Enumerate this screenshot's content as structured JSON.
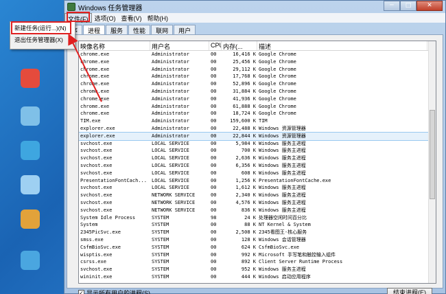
{
  "window": {
    "title": "Windows 任务管理器",
    "buttons": {
      "minimize": "─",
      "maximize": "□",
      "close": "✕"
    }
  },
  "menubar": [
    "文件(F)",
    "选项(O)",
    "查看(V)",
    "帮助(H)"
  ],
  "file_menu": {
    "items": [
      "新建任务(运行...)(N)",
      "退出任务管理器(X)"
    ]
  },
  "tabs": [
    "应用程序",
    "进程",
    "服务",
    "性能",
    "联网",
    "用户"
  ],
  "tab_partial": "序",
  "selected_tab_index": 1,
  "columns": [
    "映像名称",
    "用户名",
    "CPU",
    "内存(...",
    "描述"
  ],
  "processes": [
    {
      "name": "chrome.exe",
      "user": "Administrator",
      "cpu": "00",
      "mem": "16,416 K",
      "desc": "Google Chrome"
    },
    {
      "name": "chrome.exe",
      "user": "Administrator",
      "cpu": "00",
      "mem": "25,456 K",
      "desc": "Google Chrome"
    },
    {
      "name": "chrome.exe",
      "user": "Administrator",
      "cpu": "00",
      "mem": "29,112 K",
      "desc": "Google Chrome"
    },
    {
      "name": "chrome.exe",
      "user": "Administrator",
      "cpu": "00",
      "mem": "17,768 K",
      "desc": "Google Chrome"
    },
    {
      "name": "chrome.exe",
      "user": "Administrator",
      "cpu": "00",
      "mem": "52,896 K",
      "desc": "Google Chrome"
    },
    {
      "name": "chrome.exe",
      "user": "Administrator",
      "cpu": "00",
      "mem": "31,884 K",
      "desc": "Google Chrome"
    },
    {
      "name": "chrome.exe",
      "user": "Administrator",
      "cpu": "00",
      "mem": "41,936 K",
      "desc": "Google Chrome"
    },
    {
      "name": "chrome.exe",
      "user": "Administrator",
      "cpu": "00",
      "mem": "61,888 K",
      "desc": "Google Chrome"
    },
    {
      "name": "chrome.exe",
      "user": "Administrator",
      "cpu": "00",
      "mem": "18,724 K",
      "desc": "Google Chrome"
    },
    {
      "name": "TIM.exe",
      "user": "Administrator",
      "cpu": "00",
      "mem": "159,600 K",
      "desc": "TIM"
    },
    {
      "name": "explorer.exe",
      "user": "Administrator",
      "cpu": "00",
      "mem": "22,488 K",
      "desc": "Windows 资源管理器"
    },
    {
      "name": "explorer.exe",
      "user": "Administrator",
      "cpu": "00",
      "mem": "22,844 K",
      "desc": "Windows 资源管理器"
    },
    {
      "name": "svchost.exe",
      "user": "LOCAL SERVICE",
      "cpu": "00",
      "mem": "5,984 K",
      "desc": "Windows 服务主进程"
    },
    {
      "name": "svchost.exe",
      "user": "LOCAL SERVICE",
      "cpu": "00",
      "mem": "700 K",
      "desc": "Windows 服务主进程"
    },
    {
      "name": "svchost.exe",
      "user": "LOCAL SERVICE",
      "cpu": "00",
      "mem": "2,636 K",
      "desc": "Windows 服务主进程"
    },
    {
      "name": "svchost.exe",
      "user": "LOCAL SERVICE",
      "cpu": "00",
      "mem": "6,356 K",
      "desc": "Windows 服务主进程"
    },
    {
      "name": "svchost.exe",
      "user": "LOCAL SERVICE",
      "cpu": "00",
      "mem": "608 K",
      "desc": "Windows 服务主进程"
    },
    {
      "name": "PresentationFontCach...",
      "user": "LOCAL SERVICE",
      "cpu": "00",
      "mem": "1,256 K",
      "desc": "PresentationFontCache.exe"
    },
    {
      "name": "svchost.exe",
      "user": "LOCAL SERVICE",
      "cpu": "00",
      "mem": "1,612 K",
      "desc": "Windows 服务主进程"
    },
    {
      "name": "svchost.exe",
      "user": "NETWORK SERVICE",
      "cpu": "00",
      "mem": "2,340 K",
      "desc": "Windows 服务主进程"
    },
    {
      "name": "svchost.exe",
      "user": "NETWORK SERVICE",
      "cpu": "00",
      "mem": "4,576 K",
      "desc": "Windows 服务主进程"
    },
    {
      "name": "svchost.exe",
      "user": "NETWORK SERVICE",
      "cpu": "00",
      "mem": "836 K",
      "desc": "Windows 服务主进程"
    },
    {
      "name": "System Idle Process",
      "user": "SYSTEM",
      "cpu": "98",
      "mem": "24 K",
      "desc": "处理器空闲时间百分比"
    },
    {
      "name": "System",
      "user": "SYSTEM",
      "cpu": "00",
      "mem": "88 K",
      "desc": "NT Kernel & System"
    },
    {
      "name": "2345PicSvc.exe",
      "user": "SYSTEM",
      "cpu": "00",
      "mem": "2,508 K",
      "desc": "2345看图王-核心服务"
    },
    {
      "name": "smss.exe",
      "user": "SYSTEM",
      "cpu": "00",
      "mem": "128 K",
      "desc": "Windows 会话管理器"
    },
    {
      "name": "CsfmBioSvc.exe",
      "user": "SYSTEM",
      "cpu": "00",
      "mem": "624 K",
      "desc": "CsfmBioSvc.exe"
    },
    {
      "name": "wisptis.exe",
      "user": "SYSTEM",
      "cpu": "00",
      "mem": "992 K",
      "desc": "Microsoft 手写笔和触控输入组件"
    },
    {
      "name": "csrss.exe",
      "user": "SYSTEM",
      "cpu": "00",
      "mem": "892 K",
      "desc": "Client Server Runtime Process"
    },
    {
      "name": "svchost.exe",
      "user": "SYSTEM",
      "cpu": "00",
      "mem": "952 K",
      "desc": "Windows 服务主进程"
    },
    {
      "name": "wininit.exe",
      "user": "SYSTEM",
      "cpu": "00",
      "mem": "444 K",
      "desc": "Windows 启动应用程序"
    }
  ],
  "selected_row_index": 11,
  "show_all_users_label": "显示所有用户的进程(S)",
  "end_process_label": "结束进程(E)",
  "colors": {
    "highlight": "#e02020",
    "selection": "#e5f1fb"
  }
}
